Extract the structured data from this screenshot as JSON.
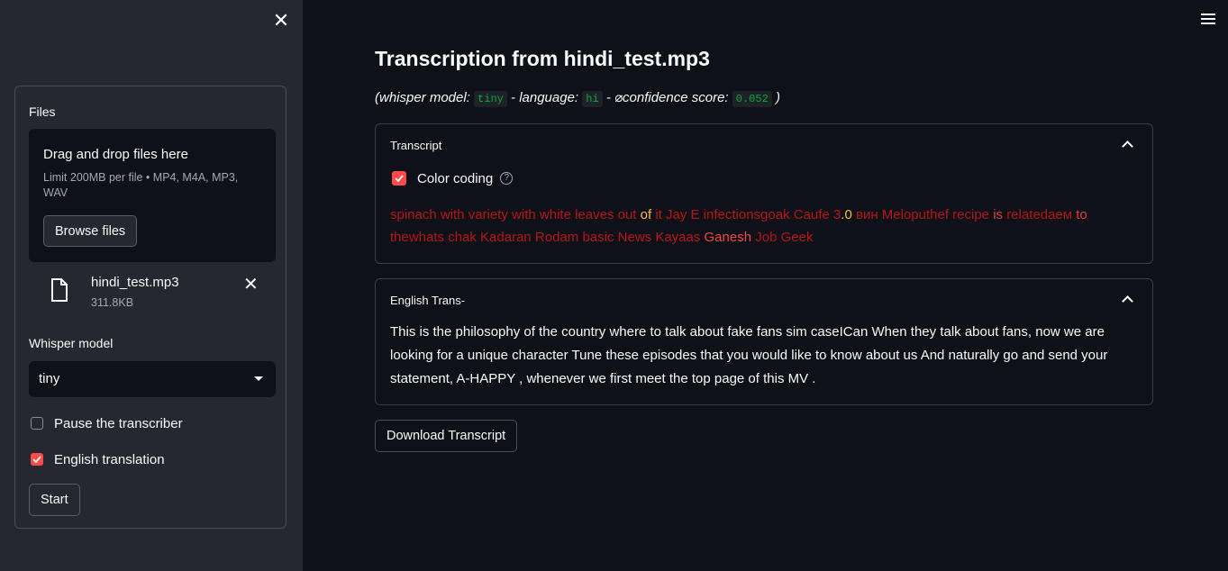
{
  "sidebar": {
    "files_label": "Files",
    "dropzone_title": "Drag and drop files here",
    "dropzone_limit": "Limit 200MB per file • MP4, M4A, MP3, WAV",
    "browse_label": "Browse files",
    "file": {
      "name": "hindi_test.mp3",
      "size": "311.8KB"
    },
    "whisper_label": "Whisper model",
    "whisper_value": "tiny",
    "pause_label": "Pause the transcriber",
    "pause_checked": false,
    "translate_label": "English translation",
    "translate_checked": true,
    "start_label": "Start",
    "close_glyph": "✕",
    "remove_glyph": "✕"
  },
  "main": {
    "title": "Transcription from hindi_test.mp3",
    "meta": {
      "prefix": "(whisper model: ",
      "model": "tiny",
      "lang_label": " - language: ",
      "lang": "hi",
      "conf_label": " - ⌀confidence score: ",
      "conf": "0.052",
      "suffix": " )"
    },
    "transcript": {
      "title": "Transcript",
      "color_coding_label": "Color coding",
      "color_coding_checked": true,
      "help_glyph": "?",
      "segments": [
        {
          "t": "spinach with variety with white leaves out ",
          "c": "#b5161b"
        },
        {
          "t": "of ",
          "c": "#ffbd45"
        },
        {
          "t": "it Jay E infectionsgoak Caufe 3",
          "c": "#b5161b"
        },
        {
          "t": ".0 ",
          "c": "#ffbd45"
        },
        {
          "t": "вин Meloputhef recipe ",
          "c": "#b5161b"
        },
        {
          "t": "is ",
          "c": "#e5393f"
        },
        {
          "t": "relatedаем ",
          "c": "#b5161b"
        },
        {
          "t": "to ",
          "c": "#e5393f"
        },
        {
          "t": "thewhats chak Kadaran Rodam basic News Kayaas ",
          "c": "#b5161b"
        },
        {
          "t": "Ganesh ",
          "c": "#f0454a"
        },
        {
          "t": "Job Geek",
          "c": "#b5161b"
        }
      ]
    },
    "english": {
      "title": "English Trans-",
      "text": "This is the philosophy of the country where to talk about fake fans sim caseICan When they talk about fans, now we are looking for a unique character Tune these episodes that you would like to know about us And naturally go and send your statement, A-HAPPY , whenever we first meet the top page of this MV ."
    },
    "download_label": "Download Transcript"
  },
  "colors": {
    "accent": "#ff4b4b",
    "background": "#0e1117",
    "sidebar": "#262730"
  }
}
